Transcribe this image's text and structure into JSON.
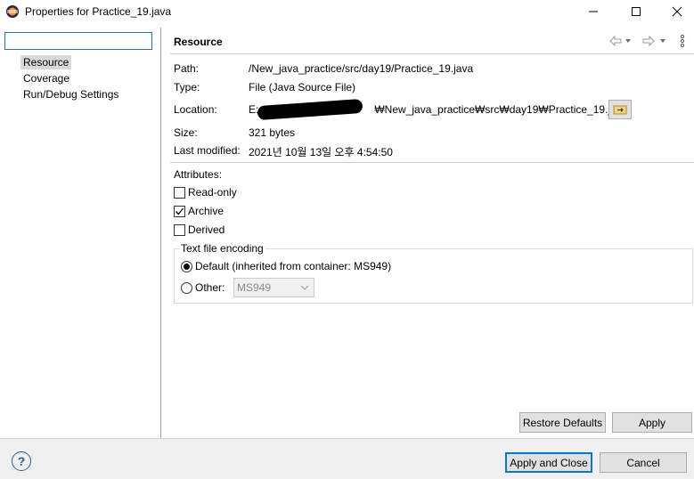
{
  "window": {
    "title": "Properties for Practice_19.java",
    "icon": "eclipse-icon"
  },
  "sidebar": {
    "filter_value": "",
    "items": [
      {
        "label": "Resource",
        "selected": true
      },
      {
        "label": "Coverage",
        "selected": false
      },
      {
        "label": "Run/Debug Settings",
        "selected": false
      }
    ]
  },
  "page": {
    "title": "Resource",
    "properties": {
      "path_label": "Path:",
      "path_value": "/New_java_practice/src/day19/Practice_19.java",
      "type_label": "Type:",
      "type_value": "File  (Java Source File)",
      "location_label": "Location:",
      "location_prefix": "E:",
      "location_value": "₩New_java_practice₩src₩day19₩Practice_19.java",
      "size_label": "Size:",
      "size_value": "321  bytes",
      "modified_label": "Last modified:",
      "modified_value": "2021년 10월 13일 오후 4:54:50"
    },
    "attributes": {
      "label": "Attributes:",
      "read_only": {
        "label": "Read-only",
        "checked": false
      },
      "archive": {
        "label": "Archive",
        "checked": true
      },
      "derived": {
        "label": "Derived",
        "checked": false
      }
    },
    "encoding": {
      "label": "Text file encoding",
      "default_option": "Default (inherited from container: MS949)",
      "other_option": "Other:",
      "selected": "default",
      "other_value": "MS949"
    },
    "restore_defaults": "Restore Defaults",
    "apply": "Apply"
  },
  "footer": {
    "apply_close": "Apply and Close",
    "cancel": "Cancel",
    "help_glyph": "?"
  }
}
